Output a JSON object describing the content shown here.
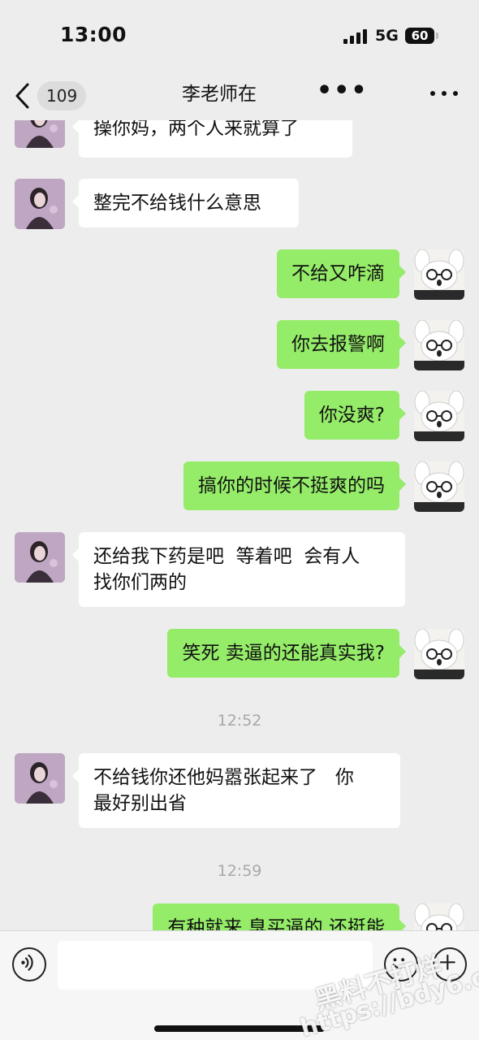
{
  "status_bar": {
    "time": "13:00",
    "network": "5G",
    "battery": "60"
  },
  "nav": {
    "unread_count": "109",
    "title": "李老师在",
    "typing": "•••"
  },
  "messages": [
    {
      "side": "in",
      "text": "操你妈，两个人来就算了"
    },
    {
      "side": "in",
      "text": "整完不给钱什么意思"
    },
    {
      "side": "out",
      "text": "不给又咋滴"
    },
    {
      "side": "out",
      "text": "你去报警啊"
    },
    {
      "side": "out",
      "text": "你没爽?"
    },
    {
      "side": "out",
      "text": "搞你的时候不挺爽的吗"
    },
    {
      "side": "in",
      "text": "还给我下药是吧  等着吧  会有人\n找你们两的"
    },
    {
      "side": "out",
      "text": "笑死 卖逼的还能真实我?"
    },
    {
      "side": "time",
      "text": "12:52"
    },
    {
      "side": "in",
      "text": "不给钱你还他妈嚣张起来了   你\n最好别出省"
    },
    {
      "side": "time",
      "text": "12:59"
    },
    {
      "side": "out",
      "text": "有种就来 臭买逼的 还挺能"
    }
  ],
  "watermark": {
    "line1": "黑料不打烊",
    "line2": "https://bdy6.co"
  },
  "colors": {
    "outgoing_bubble": "#95ec69",
    "incoming_bubble": "#ffffff",
    "background": "#ededed"
  },
  "icons": {
    "back": "chevron-left-icon",
    "more": "more-dots-icon",
    "voice": "voice-icon",
    "emoji": "emoji-icon",
    "plus": "plus-icon"
  }
}
